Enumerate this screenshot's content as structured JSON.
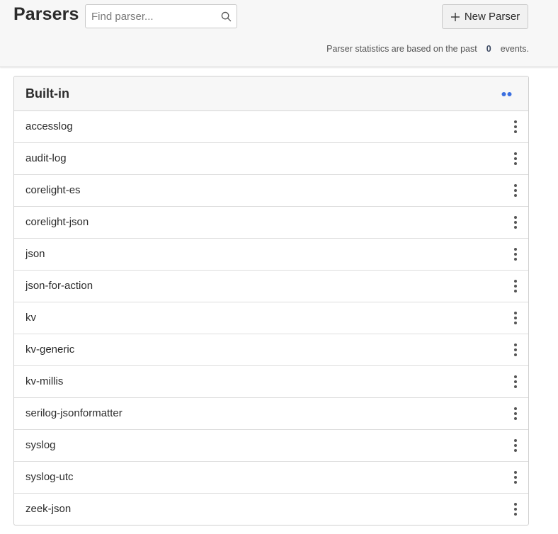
{
  "header": {
    "title": "Parsers",
    "search_placeholder": "Find parser...",
    "search_value": "",
    "new_button_label": "New Parser",
    "stats_prefix": "Parser statistics are based on the past",
    "stats_count": "0",
    "stats_suffix": "events."
  },
  "panel": {
    "title": "Built-in",
    "accent_color": "#3b6fe0",
    "items": [
      {
        "label": "accesslog"
      },
      {
        "label": "audit-log"
      },
      {
        "label": "corelight-es"
      },
      {
        "label": "corelight-json"
      },
      {
        "label": "json"
      },
      {
        "label": "json-for-action"
      },
      {
        "label": "kv"
      },
      {
        "label": "kv-generic"
      },
      {
        "label": "kv-millis"
      },
      {
        "label": "serilog-jsonformatter"
      },
      {
        "label": "syslog"
      },
      {
        "label": "syslog-utc"
      },
      {
        "label": "zeek-json"
      }
    ]
  },
  "icons": {
    "search": "search-icon",
    "new": "plus-icon",
    "header_dots": "dots-horizontal-icon",
    "row_menu": "kebab-menu-icon"
  }
}
